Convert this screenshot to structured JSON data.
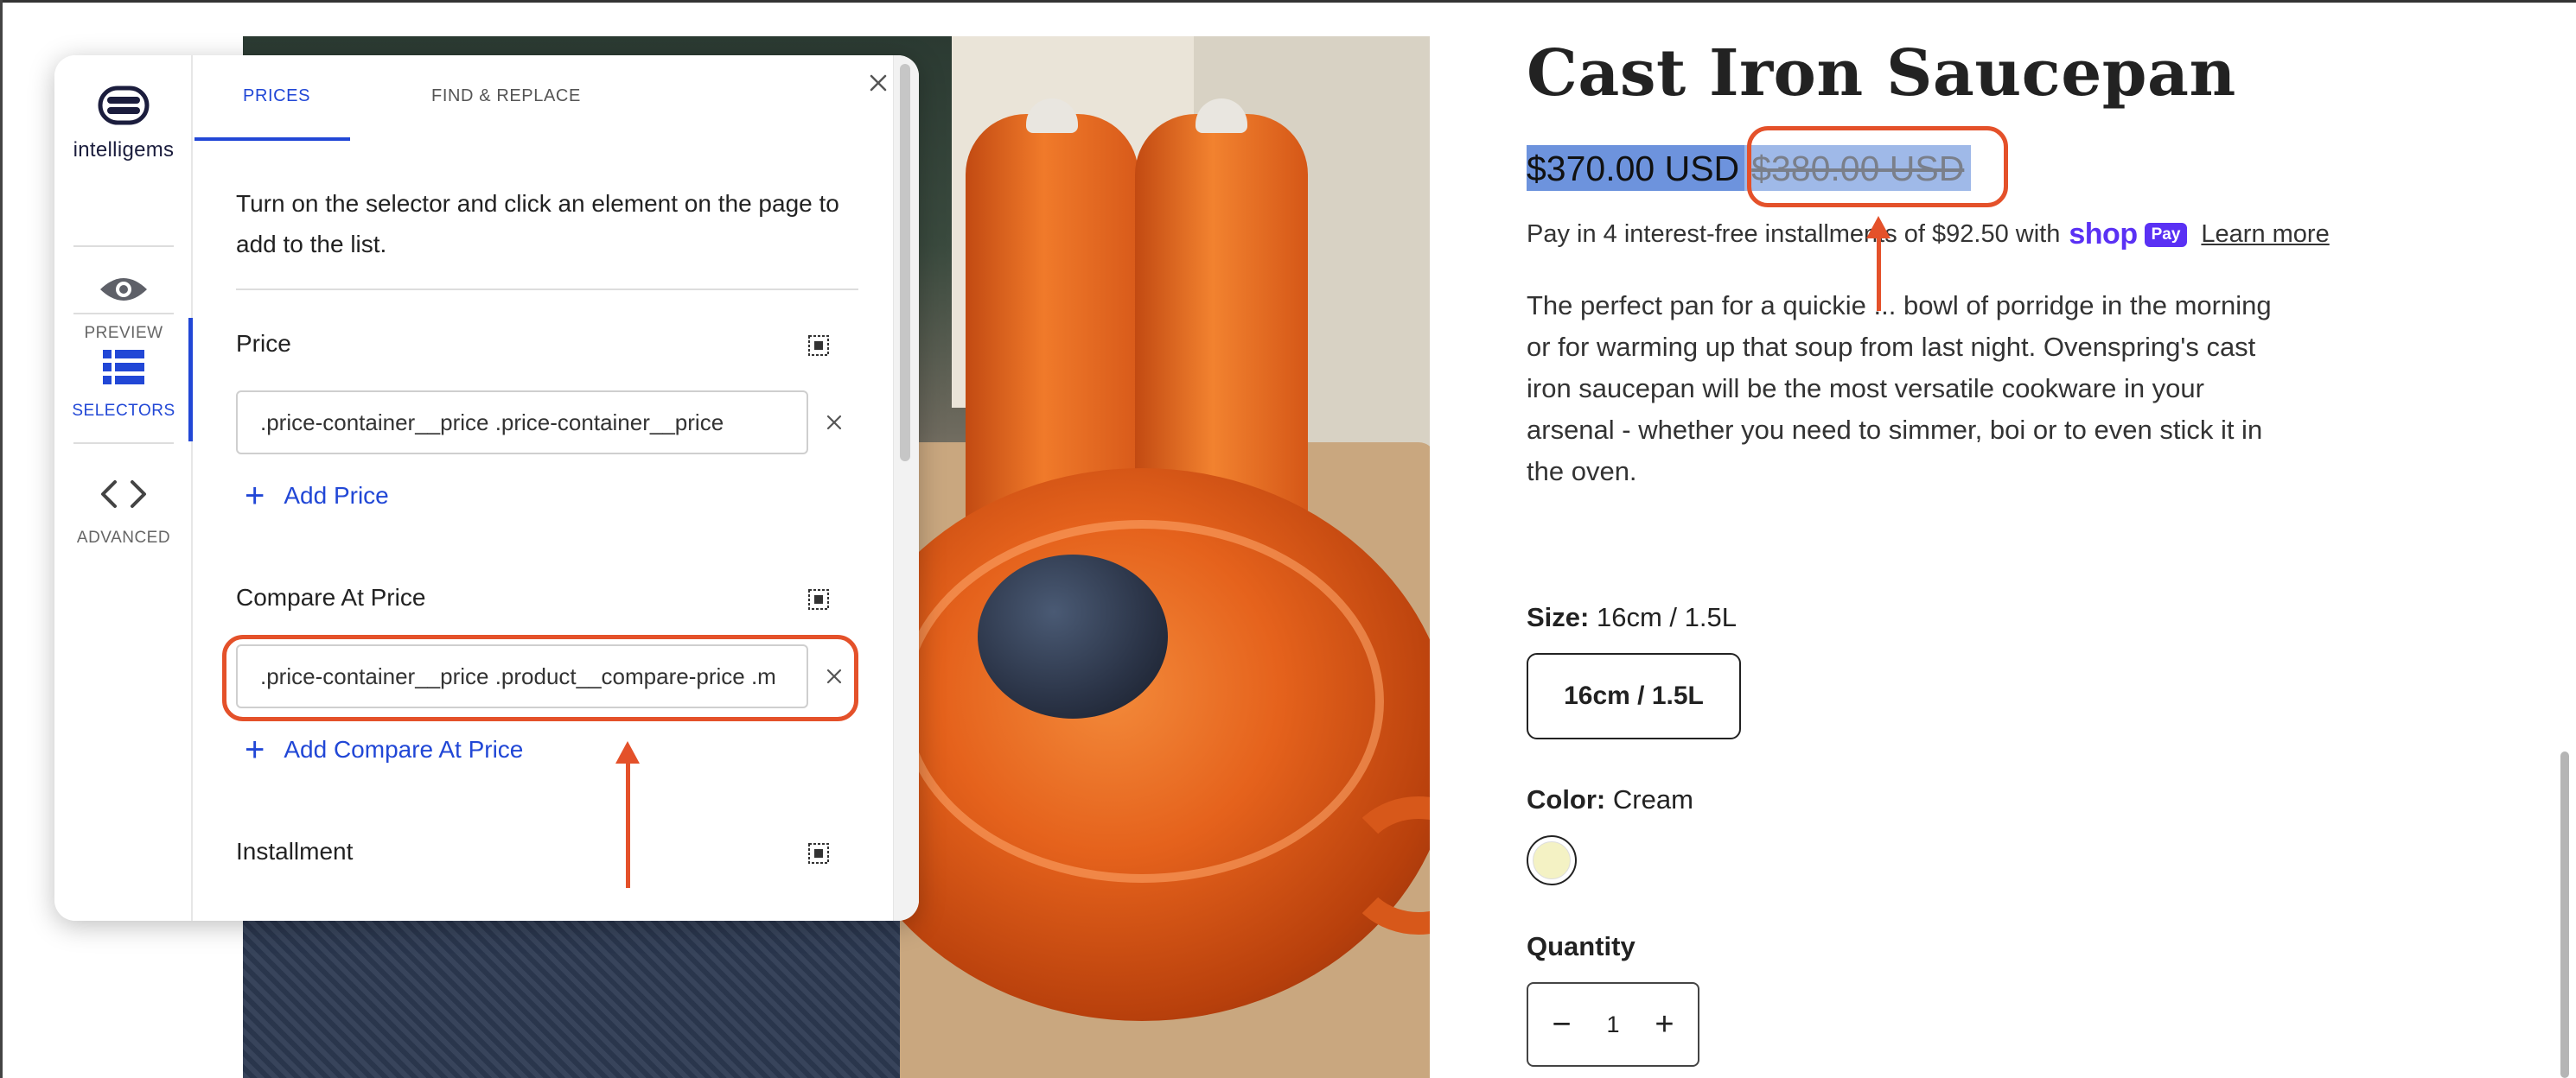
{
  "panel": {
    "brand": "intelligems",
    "rail": [
      {
        "label": "PREVIEW",
        "icon": "eye-icon"
      },
      {
        "label": "SELECTORS",
        "icon": "list-icon"
      },
      {
        "label": "ADVANCED",
        "icon": "code-icon"
      }
    ],
    "tabs": [
      "PRICES",
      "FIND & REPLACE"
    ],
    "active_tab": "PRICES",
    "intro": "Turn on the selector and click an element on the page to add to the list.",
    "sections": {
      "price": {
        "title": "Price",
        "value": ".price-container__price .price-container__price",
        "add_label": "Add Price"
      },
      "compare": {
        "title": "Compare At Price",
        "value": ".price-container__price .product__compare-price .m",
        "add_label": "Add Compare At Price"
      },
      "installment": {
        "title": "Installment"
      }
    }
  },
  "product": {
    "title": "Cast Iron Saucepan",
    "price": "$370.00 USD",
    "compare_price": "$380.00 USD",
    "pay_text": "Pay in 4 interest-free installments of $92.50 with",
    "shop_brand": "shop",
    "pay_badge": "Pay",
    "learn_more": "Learn more",
    "description": "The perfect pan for a quickie ... bowl of porridge in the morning or for warming up that soup from last night. Ovenspring's cast iron saucepan will be the most versatile cookware in your arsenal - whether you need to simmer, boi or to even stick it in the oven.",
    "size_label": "Size:",
    "size_value": "16cm / 1.5L",
    "size_option": "16cm / 1.5L",
    "color_label": "Color:",
    "color_value": "Cream",
    "swatch_color": "#f4f2c4",
    "quantity_label": "Quantity",
    "quantity": "1"
  },
  "colors": {
    "accent": "#2147d6",
    "annotation": "#e4512a",
    "price_highlight": "#6d93dd",
    "shop_pay": "#5a31f4"
  }
}
